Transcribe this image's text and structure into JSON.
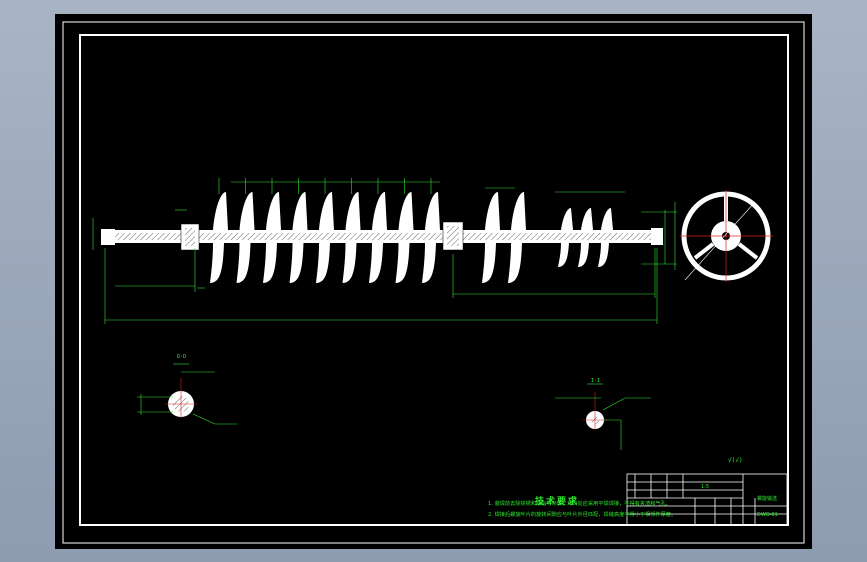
{
  "drawing": {
    "section_label_1": "D-D",
    "section_label_2": "I-I",
    "surface_finish": "√(√)",
    "notes_title": "技术要求",
    "notes": [
      "1. 装焊前去除铁锈和油脂等杂质。焊口处应采用平焊焊接，不得有夹渣和气孔。",
      "2. 焊接后螺旋叶片的旋转间隙应与叶片外径匹配，焊缝高度不得小于相邻件厚度。"
    ],
    "title_block": {
      "name": "螺旋输送",
      "code": "DWG-01",
      "scale": "1:5"
    },
    "colors": {
      "background": "#000000",
      "line": "#ffffff",
      "dimension": "#2ee82e",
      "axis": "#e02020"
    }
  }
}
